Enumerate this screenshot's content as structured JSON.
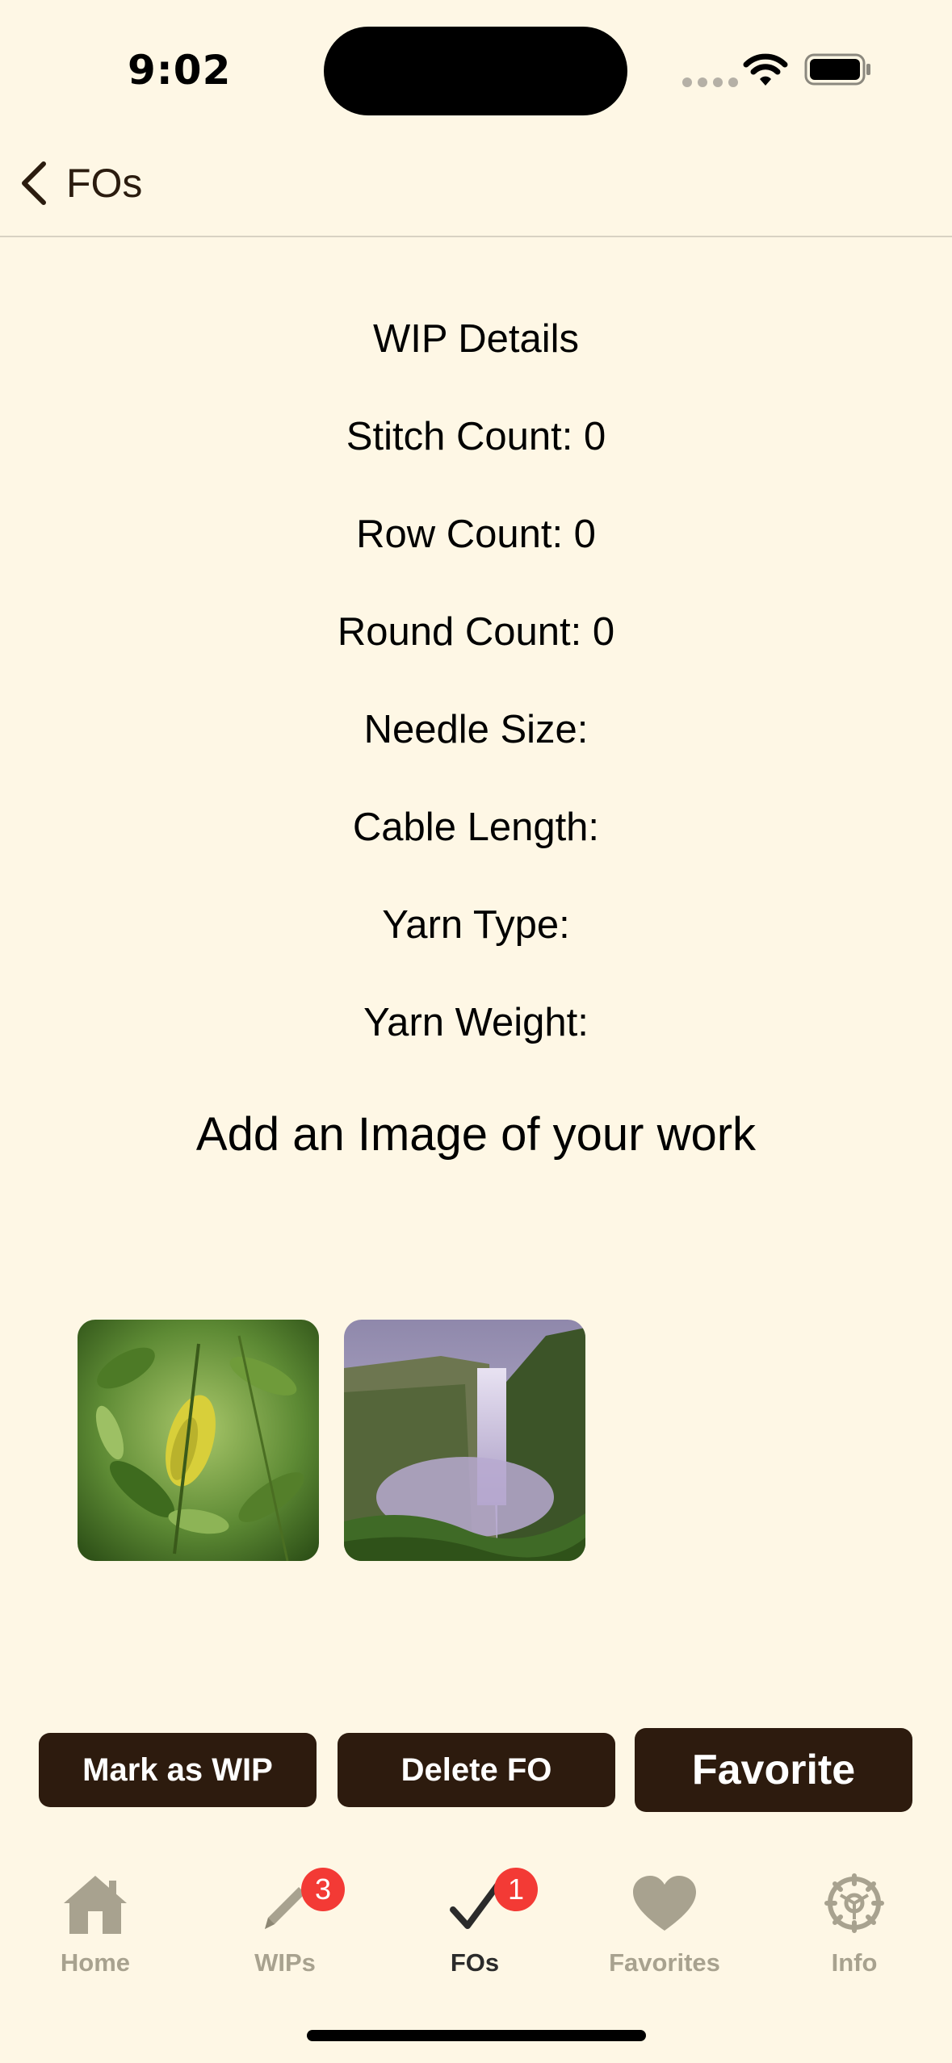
{
  "status_bar": {
    "time": "9:02"
  },
  "nav": {
    "back_label": "FOs"
  },
  "details": {
    "title": "WIP Details",
    "stitch_count": "Stitch Count: 0",
    "row_count": "Row Count: 0",
    "round_count": "Round Count: 0",
    "needle_size": "Needle Size:",
    "cable_length": "Cable Length:",
    "yarn_type": "Yarn Type:",
    "yarn_weight": "Yarn Weight:"
  },
  "images": {
    "title": "Add an Image of your work",
    "items": [
      {
        "name": "leaf-photo"
      },
      {
        "name": "waterfall-photo"
      }
    ]
  },
  "actions": {
    "mark_wip": "Mark as WIP",
    "delete_fo": "Delete FO",
    "favorite": "Favorite"
  },
  "tabs": [
    {
      "label": "Home",
      "icon": "house-icon",
      "badge": null,
      "active": false
    },
    {
      "label": "WIPs",
      "icon": "pencil-icon",
      "badge": "3",
      "active": false
    },
    {
      "label": "FOs",
      "icon": "checkmark-icon",
      "badge": "1",
      "active": true
    },
    {
      "label": "Favorites",
      "icon": "heart-icon",
      "badge": null,
      "active": false
    },
    {
      "label": "Info",
      "icon": "gear-icon",
      "badge": null,
      "active": false
    }
  ],
  "colors": {
    "background": "#fef7e5",
    "button": "#2d1b0e",
    "badge": "#f33a35",
    "tab_inactive": "#a8a28f",
    "tab_active": "#2b2b2b"
  }
}
